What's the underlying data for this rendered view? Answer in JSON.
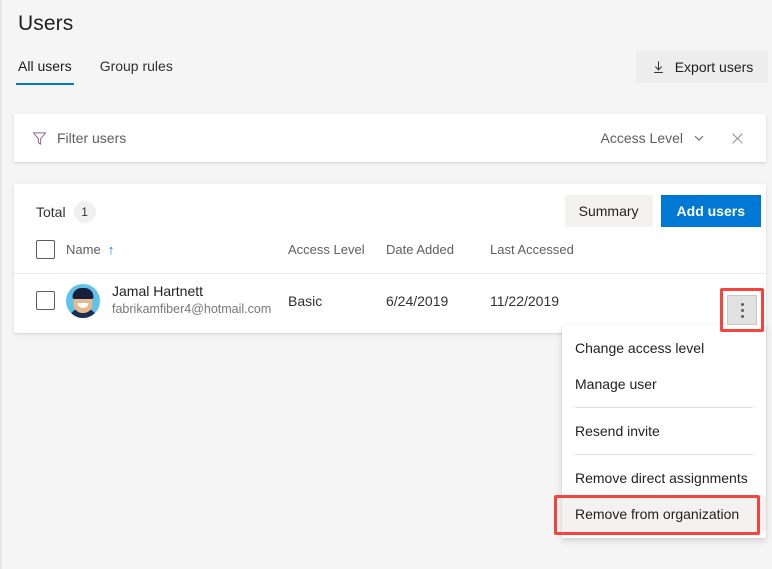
{
  "header": {
    "title": "Users",
    "tabs": [
      {
        "label": "All users",
        "active": true
      },
      {
        "label": "Group rules",
        "active": false
      }
    ],
    "export_button": {
      "label": "Export users",
      "icon": "download-icon"
    }
  },
  "filter_bar": {
    "icon": "filter-funnel-icon",
    "placeholder": "Filter users",
    "access_level_label": "Access Level",
    "chevron_icon": "chevron-down-icon",
    "clear_icon": "close-icon"
  },
  "table_toolbar": {
    "total_label": "Total",
    "total_count": "1",
    "summary_button": "Summary",
    "add_users_button": "Add users"
  },
  "table": {
    "columns": [
      {
        "key": "check",
        "label": ""
      },
      {
        "key": "name",
        "label": "Name",
        "sorted": "asc",
        "sort_icon": "arrow-up-icon"
      },
      {
        "key": "access_level",
        "label": "Access Level"
      },
      {
        "key": "date_added",
        "label": "Date Added"
      },
      {
        "key": "last_accessed",
        "label": "Last Accessed"
      },
      {
        "key": "actions",
        "label": ""
      }
    ],
    "rows": [
      {
        "name": "Jamal Hartnett",
        "email": "fabrikamfiber4@hotmail.com",
        "access_level": "Basic",
        "date_added": "6/24/2019",
        "last_accessed": "11/22/2019",
        "avatar": "user-avatar",
        "actions_icon": "more-vertical-icon"
      }
    ]
  },
  "context_menu": {
    "items": [
      {
        "label": "Change access level",
        "separator_after": false
      },
      {
        "label": "Manage user",
        "separator_after": true
      },
      {
        "label": "Resend invite",
        "separator_after": true
      },
      {
        "label": "Remove direct assignments",
        "separator_after": false
      },
      {
        "label": "Remove from organization",
        "separator_after": false,
        "highlighted": true
      }
    ]
  },
  "colors": {
    "accent": "#0078d4",
    "highlight_outline": "#f5443c",
    "page_background": "#f5f5f5",
    "card_background": "#ffffff"
  }
}
